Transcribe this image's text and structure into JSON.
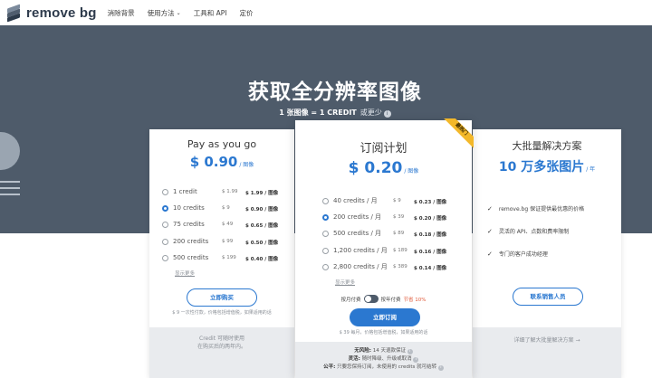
{
  "header": {
    "logo_text": "remove bg",
    "nav": [
      {
        "label": "消除背景"
      },
      {
        "label": "使用方法",
        "has_dropdown": true
      },
      {
        "label": "工具和 API"
      },
      {
        "label": "定价"
      }
    ]
  },
  "hero": {
    "title": "获取全分辨率图像",
    "sub_bold": "1 张图像 = 1 CREDIT",
    "sub_muted": "或更少"
  },
  "payg": {
    "title": "Pay as you go",
    "price": "$ 0.90",
    "price_unit": "/ 图像",
    "options": [
      {
        "label": "1 credit",
        "price": "$ 1.99",
        "unit": "$ 1.99 / 图像",
        "selected": false
      },
      {
        "label": "10 credits",
        "price": "$ 9",
        "unit": "$ 0.90 / 图像",
        "selected": true
      },
      {
        "label": "75 credits",
        "price": "$ 49",
        "unit": "$ 0.65 / 图像",
        "selected": false
      },
      {
        "label": "200 credits",
        "price": "$ 99",
        "unit": "$ 0.50 / 图像",
        "selected": false
      },
      {
        "label": "500 credits",
        "price": "$ 199",
        "unit": "$ 0.40 / 图像",
        "selected": false
      }
    ],
    "show_more": "显示更多",
    "button": "立即购买",
    "fine_print": "$ 9 一次性付款，价格包括增值税，如果适用的话",
    "footer_line1": "Credit 可随时使用",
    "footer_line2": "在购买后的两年内。"
  },
  "subscription": {
    "badge": "最热门",
    "title": "订阅计划",
    "price": "$ 0.20",
    "price_unit": "/ 图像",
    "options": [
      {
        "label": "40 credits / 月",
        "price": "$ 9",
        "unit": "$ 0.23 / 图像",
        "selected": false
      },
      {
        "label": "200 credits / 月",
        "price": "$ 39",
        "unit": "$ 0.20 / 图像",
        "selected": true
      },
      {
        "label": "500 credits / 月",
        "price": "$ 89",
        "unit": "$ 0.18 / 图像",
        "selected": false
      },
      {
        "label": "1,200 credits / 月",
        "price": "$ 189",
        "unit": "$ 0.16 / 图像",
        "selected": false
      },
      {
        "label": "2,800 credits / 月",
        "price": "$ 389",
        "unit": "$ 0.14 / 图像",
        "selected": false
      }
    ],
    "show_more": "显示更多",
    "toggle_monthly": "按月付费",
    "toggle_yearly": "按年付费",
    "toggle_save": "节省 10%",
    "button": "立即订阅",
    "fine_print": "$ 39 每月，价格包括增值税，如果适用的话",
    "footer_lines": [
      {
        "bold": "无风险:",
        "text": "14 天退款保证"
      },
      {
        "bold": "灵活:",
        "text": "随时降级、升级或取消"
      },
      {
        "bold": "公平:",
        "text": "只要您保持订阅，未使用的 credits 就可结转"
      }
    ]
  },
  "bulk": {
    "title": "大批量解决方案",
    "price": "10 万多张图片",
    "price_unit": "/ 年",
    "features": [
      "remove.bg 保证提供最优惠的价格",
      "灵活的 API、点数和费率限制",
      "专门的客户成功经理"
    ],
    "button": "联系销售人员",
    "footer_link": "详细了解大批量解决方案 →"
  },
  "colors": {
    "hero_bg": "#4e5b6a",
    "accent_blue": "#2b78d0",
    "badge_yellow": "#f3b82a",
    "footer_gray": "#e9ebee"
  }
}
